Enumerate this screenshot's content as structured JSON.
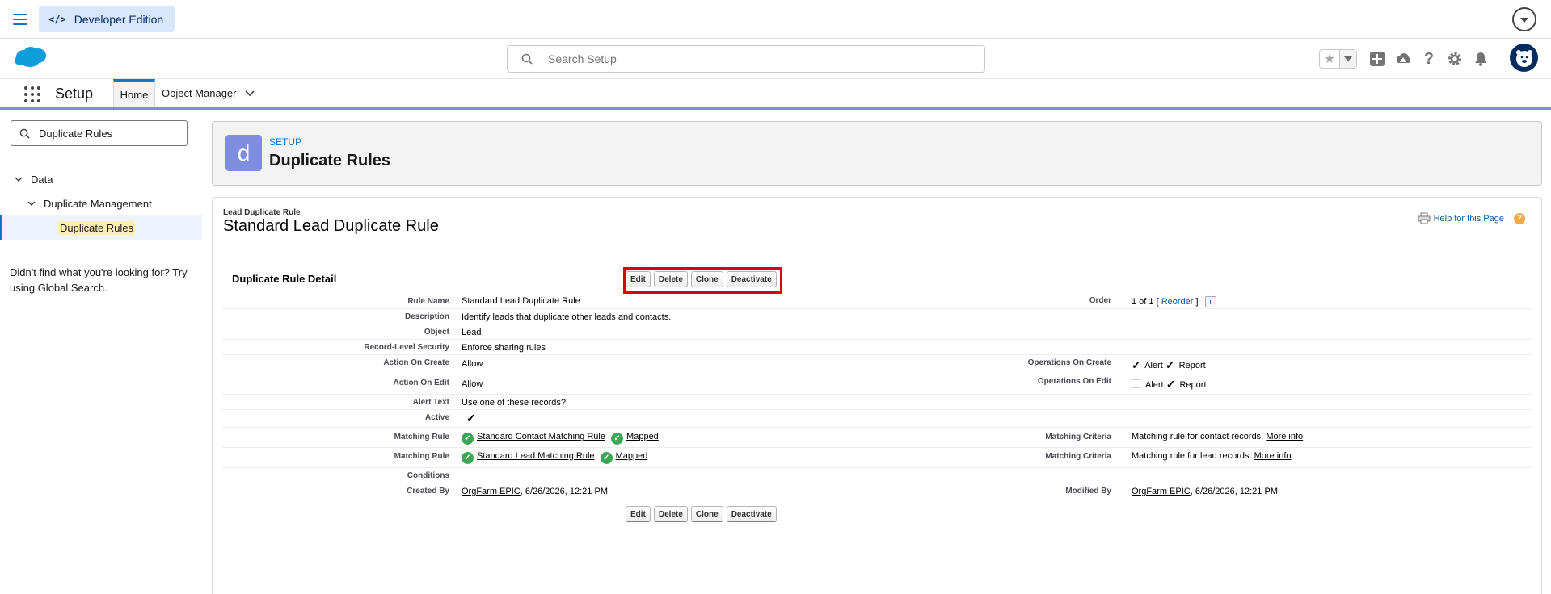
{
  "topbar": {
    "app_label": "Developer Edition"
  },
  "header": {
    "search_placeholder": "Search Setup"
  },
  "nav": {
    "title": "Setup",
    "tabs": [
      {
        "label": "Home"
      },
      {
        "label": "Object Manager"
      }
    ]
  },
  "sidebar": {
    "search_value": "Duplicate Rules",
    "tree": [
      {
        "label": "Data"
      },
      {
        "label": "Duplicate Management"
      },
      {
        "label": "Duplicate Rules"
      }
    ],
    "not_found": "Didn't find what you're looking for? Try using Global Search."
  },
  "page_header": {
    "icon_letter": "d",
    "eyebrow": "SETUP",
    "title": "Duplicate Rules"
  },
  "record": {
    "type_label": "Lead Duplicate Rule",
    "title": "Standard Lead Duplicate Rule",
    "help_link": "Help for this Page",
    "help_icon": "?",
    "section_title": "Duplicate Rule Detail",
    "buttons": {
      "edit": "Edit",
      "delete": "Delete",
      "clone": "Clone",
      "deactivate": "Deactivate"
    },
    "fields": {
      "rule_name": {
        "label": "Rule Name",
        "value": "Standard Lead Duplicate Rule"
      },
      "order": {
        "label": "Order",
        "value": "1 of 1 [",
        "reorder": "Reorder",
        "close": " ]",
        "info": "i"
      },
      "description": {
        "label": "Description",
        "value": "Identify leads that duplicate other leads and contacts."
      },
      "object": {
        "label": "Object",
        "value": "Lead"
      },
      "record_security": {
        "label": "Record-Level Security",
        "value": "Enforce sharing rules"
      },
      "action_on_create": {
        "label": "Action On Create",
        "value": "Allow"
      },
      "operations_on_create": {
        "label": "Operations On Create",
        "alert": "Alert",
        "report": "Report"
      },
      "action_on_edit": {
        "label": "Action On Edit",
        "value": "Allow"
      },
      "operations_on_edit": {
        "label": "Operations On Edit",
        "alert": "Alert",
        "report": "Report"
      },
      "alert_text": {
        "label": "Alert Text",
        "value": "Use one of these records?"
      },
      "active": {
        "label": "Active"
      },
      "matching_rule_1": {
        "label": "Matching Rule",
        "rule": "Standard Contact Matching Rule",
        "status": "Mapped",
        "criteria_label": "Matching Criteria",
        "criteria": "Matching rule for contact records.",
        "more": "More info"
      },
      "matching_rule_2": {
        "label": "Matching Rule",
        "rule": "Standard Lead Matching Rule",
        "status": "Mapped",
        "criteria_label": "Matching Criteria",
        "criteria": "Matching rule for lead records.",
        "more": "More info"
      },
      "conditions": {
        "label": "Conditions"
      },
      "created_by": {
        "label": "Created By",
        "user": "OrgFarm EPIC",
        "date": ", 6/26/2026, 12:21 PM"
      },
      "modified_by": {
        "label": "Modified By",
        "user": "OrgFarm EPIC",
        "date": ", 6/26/2026, 12:21 PM"
      }
    }
  },
  "colors": {
    "brand": "#0176d3",
    "setup_icon": "#7f8de1",
    "highlight": "#e00000",
    "mapped": "#3ba755"
  }
}
